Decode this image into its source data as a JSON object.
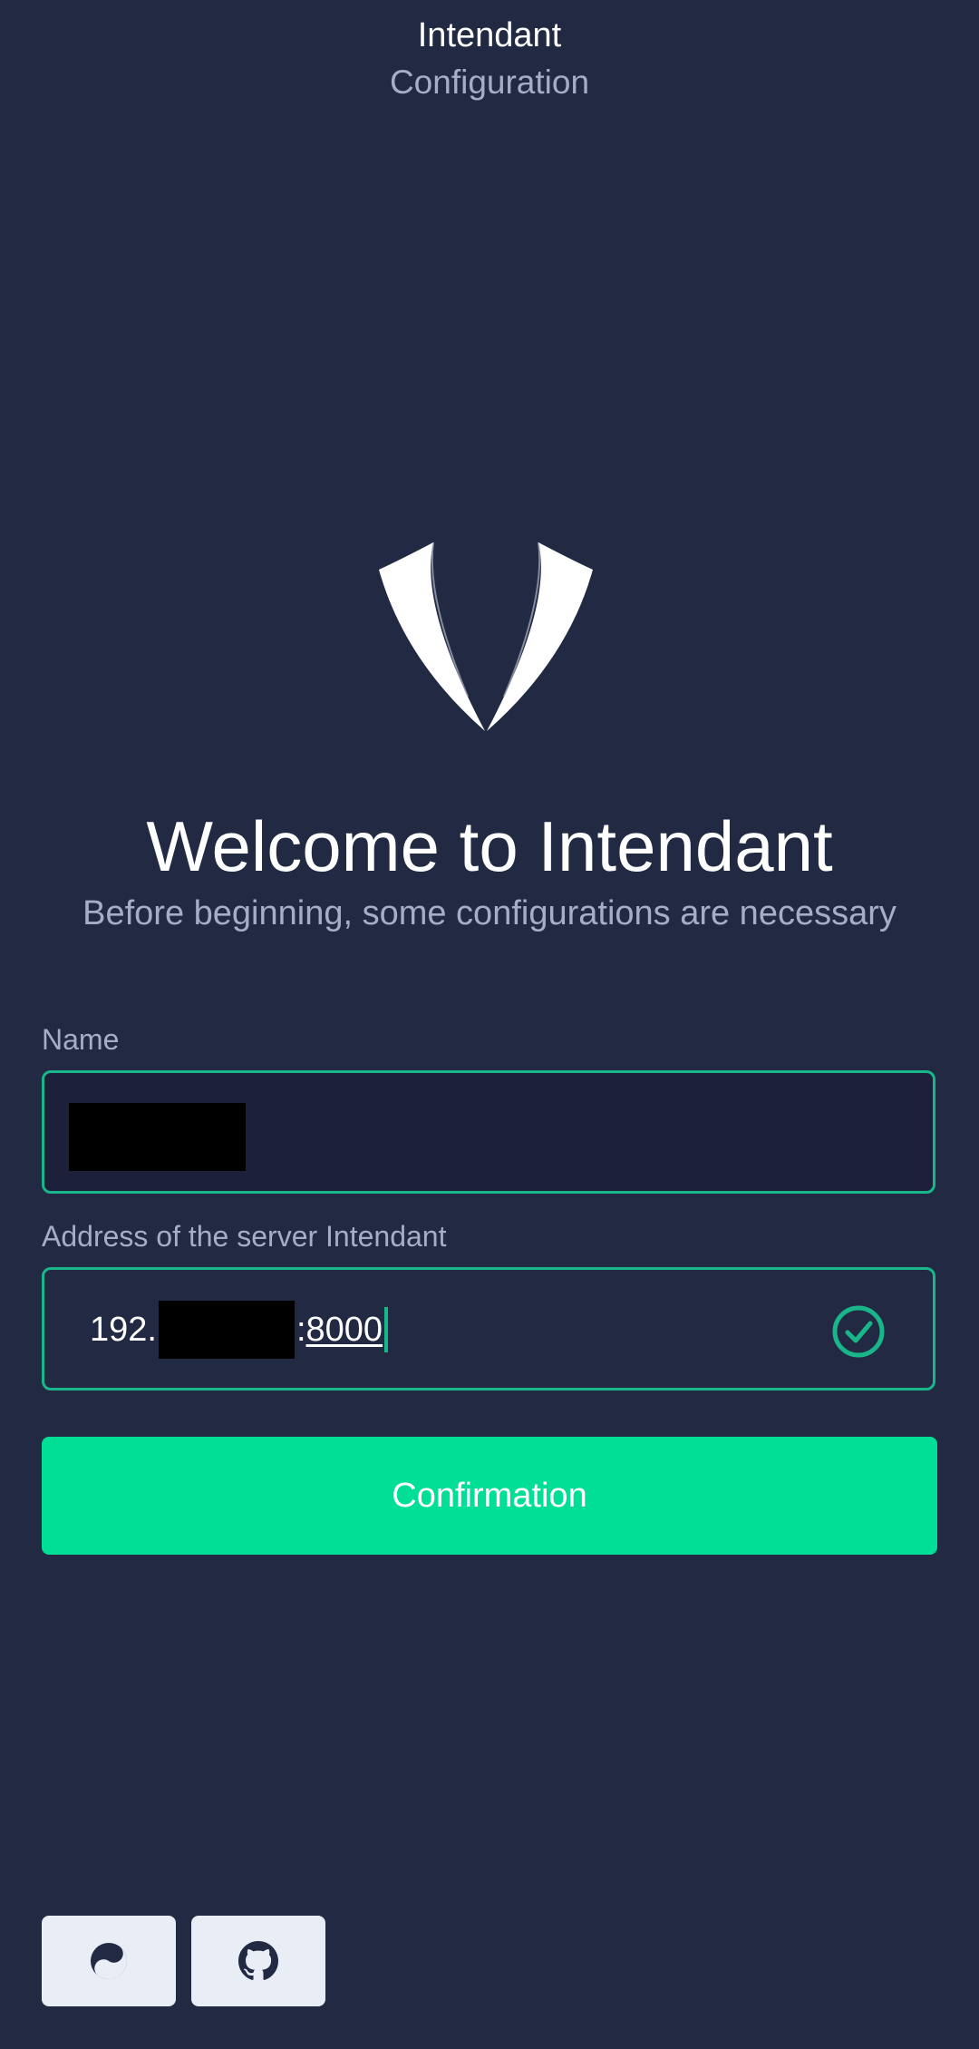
{
  "header": {
    "title": "Intendant",
    "subtitle": "Configuration"
  },
  "logo": {
    "icon": "lapel-logo-icon"
  },
  "welcome": {
    "title": "Welcome to Intendant",
    "subtitle": "Before beginning, some configurations are necessary"
  },
  "form": {
    "name_label": "Name",
    "address_label": "Address of the server Intendant",
    "address_prefix": "192.",
    "address_separator": ":",
    "address_port": "8000",
    "address_valid_icon": "check-circle-icon",
    "confirm_label": "Confirmation"
  },
  "footer": {
    "buttons": [
      {
        "icon": "theme-toggle-icon"
      },
      {
        "icon": "github-icon"
      }
    ]
  },
  "colors": {
    "background": "#222a43",
    "accent": "#00df95",
    "border": "#19b68a",
    "muted_text": "#a6adc6"
  }
}
